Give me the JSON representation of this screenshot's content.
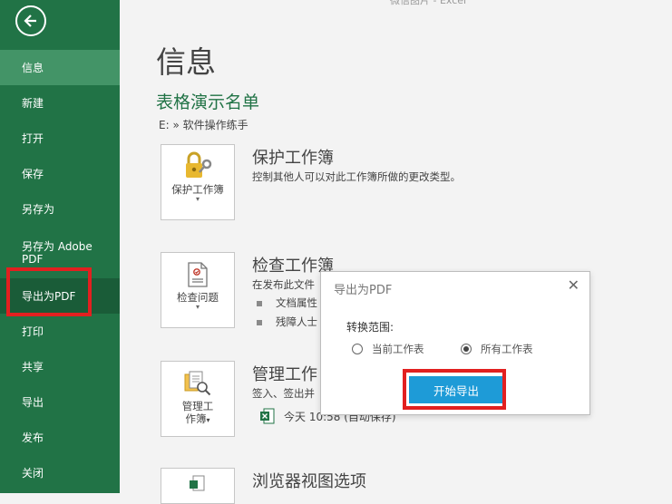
{
  "window": {
    "top_text": "微信图片 - Excel"
  },
  "sidebar": {
    "back_icon": "back-arrow-icon",
    "items": [
      {
        "label": "信息"
      },
      {
        "label": "新建"
      },
      {
        "label": "打开"
      },
      {
        "label": "保存"
      },
      {
        "label": "另存为"
      },
      {
        "label": "另存为 Adobe PDF"
      },
      {
        "label": "导出为PDF"
      },
      {
        "label": "打印"
      },
      {
        "label": "共享"
      },
      {
        "label": "导出"
      },
      {
        "label": "发布"
      },
      {
        "label": "关闭"
      }
    ]
  },
  "main": {
    "heading": "信息",
    "workbook_name": "表格演示名单",
    "path": "E: » 软件操作练手",
    "protect": {
      "button_line1": "保护工作簿",
      "title": "保护工作簿",
      "desc": "控制其他人可以对此工作簿所做的更改类型。"
    },
    "inspect": {
      "button_line1": "检查问题",
      "title": "检查工作簿",
      "desc": "在发布此文件",
      "bullet1": "文档属性",
      "bullet2": "残障人士"
    },
    "manage": {
      "button_line1": "管理工",
      "button_line2": "作簿",
      "title": "管理工作",
      "desc": "签入、签出并",
      "file_entry": "今天 10:58 (自动保存)"
    },
    "browser": {
      "title": "浏览器视图选项"
    }
  },
  "dialog": {
    "title": "导出为PDF",
    "range_label": "转换范围:",
    "option_current": "当前工作表",
    "option_all": "所有工作表",
    "selected": "所有工作表",
    "start_button": "开始导出"
  },
  "colors": {
    "sidebar": "#217346",
    "accent_green": "#217346",
    "button_blue": "#1e9bd7",
    "highlight_red": "#e22020"
  }
}
